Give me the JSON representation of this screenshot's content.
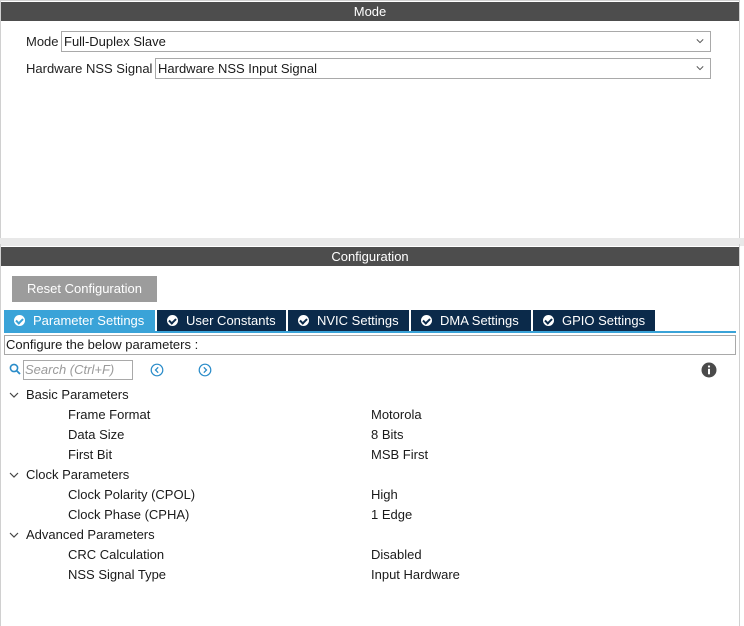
{
  "mode": {
    "header": "Mode",
    "fields": [
      {
        "label": "Mode",
        "value": "Full-Duplex Slave"
      },
      {
        "label": "Hardware NSS Signal",
        "value": "Hardware NSS Input Signal"
      }
    ]
  },
  "configuration": {
    "header": "Configuration",
    "reset_label": "Reset Configuration",
    "tabs": [
      {
        "label": "Parameter Settings",
        "active": true
      },
      {
        "label": "User Constants"
      },
      {
        "label": "NVIC Settings"
      },
      {
        "label": "DMA Settings"
      },
      {
        "label": "GPIO Settings"
      }
    ],
    "description": "Configure the below parameters :",
    "search_placeholder": "Search (Ctrl+F)",
    "groups": [
      {
        "label": "Basic Parameters",
        "params": [
          {
            "name": "Frame Format",
            "value": "Motorola"
          },
          {
            "name": "Data Size",
            "value": "8 Bits"
          },
          {
            "name": "First Bit",
            "value": "MSB First"
          }
        ]
      },
      {
        "label": "Clock Parameters",
        "params": [
          {
            "name": "Clock Polarity (CPOL)",
            "value": "High"
          },
          {
            "name": "Clock Phase (CPHA)",
            "value": "1 Edge"
          }
        ]
      },
      {
        "label": "Advanced Parameters",
        "params": [
          {
            "name": "CRC Calculation",
            "value": "Disabled"
          },
          {
            "name": "NSS Signal Type",
            "value": "Input Hardware"
          }
        ]
      }
    ]
  },
  "colors": {
    "header_bg": "#4d4d4d",
    "tab_bg": "#0b2a4a",
    "tab_active_bg": "#3aa3d8",
    "reset_bg": "#9c9c9c"
  }
}
